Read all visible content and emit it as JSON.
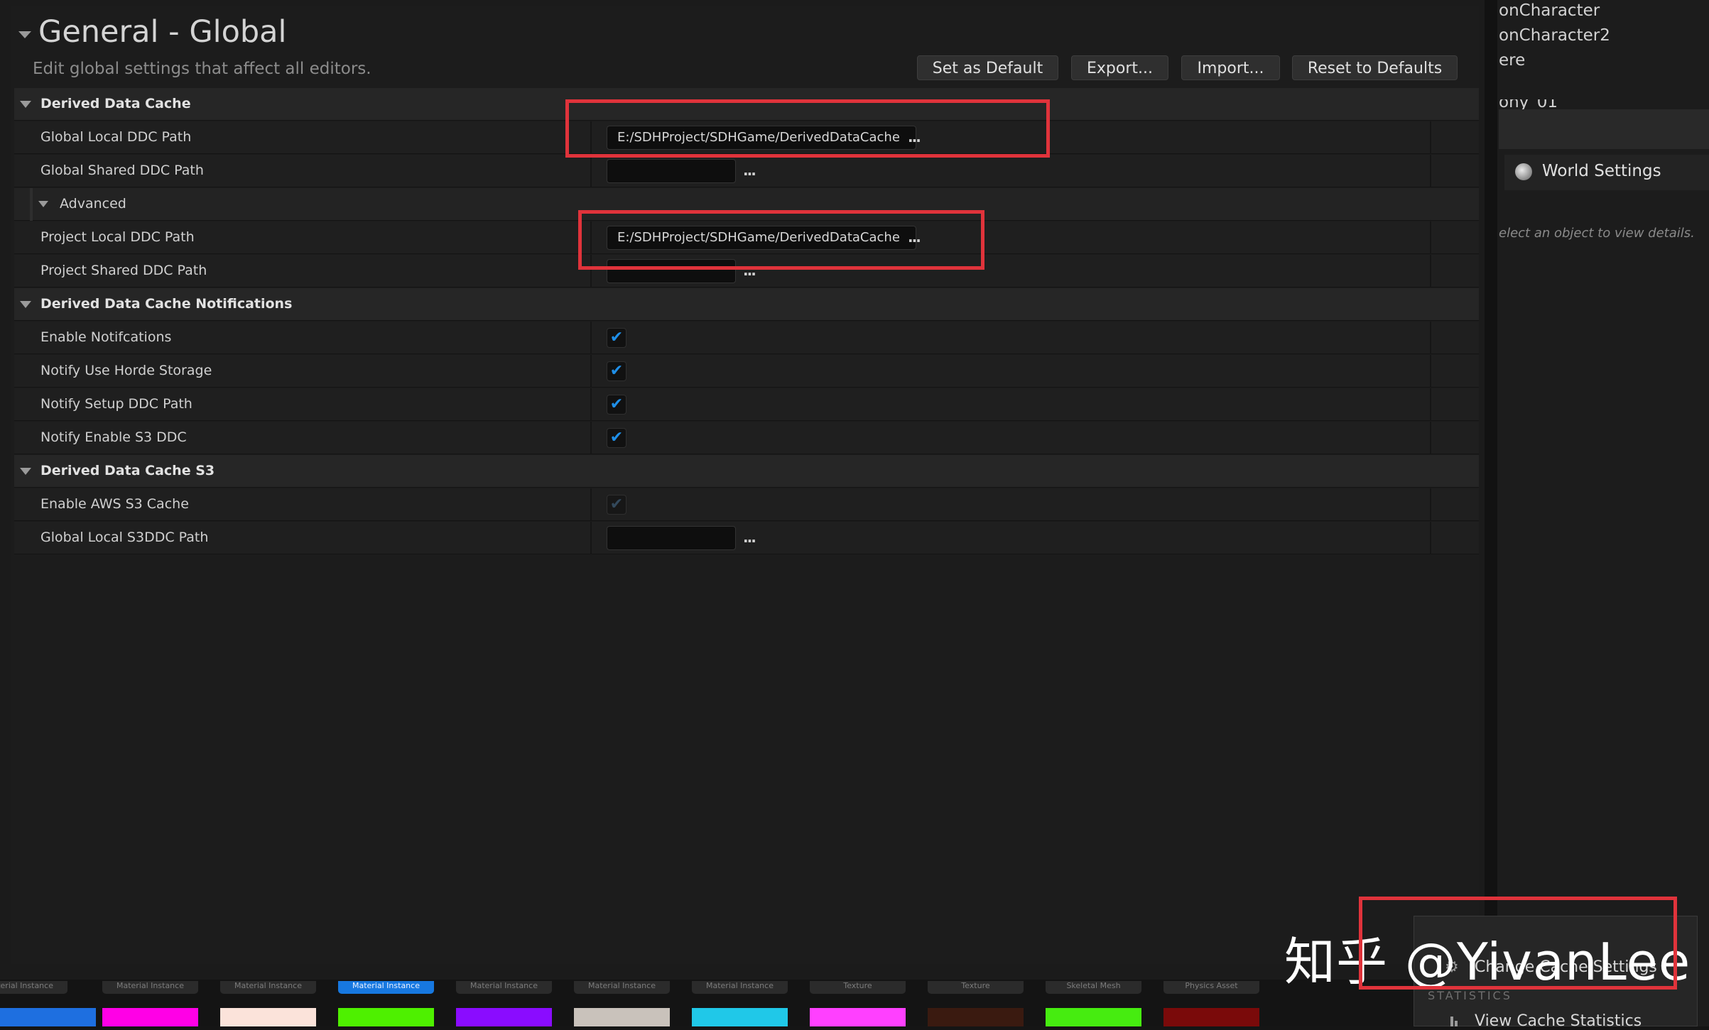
{
  "header": {
    "title": "General - Global",
    "subtitle": "Edit global settings that affect all editors.",
    "buttons": {
      "set_default": "Set as Default",
      "export": "Export...",
      "import": "Import...",
      "reset": "Reset to Defaults"
    }
  },
  "sections": {
    "ddc": {
      "title": "Derived Data Cache",
      "global_local_label": "Global Local DDC Path",
      "global_local_value": "E:/SDHProject/SDHGame/DerivedDataCache",
      "global_shared_label": "Global Shared DDC Path",
      "advanced_label": "Advanced",
      "project_local_label": "Project Local DDC Path",
      "project_local_value": "E:/SDHProject/SDHGame/DerivedDataCache",
      "project_shared_label": "Project Shared DDC Path"
    },
    "notifications": {
      "title": "Derived Data Cache Notifications",
      "enable_label": "Enable Notifcations",
      "horde_label": "Notify Use Horde Storage",
      "setup_label": "Notify Setup DDC Path",
      "s3_label": "Notify Enable S3 DDC"
    },
    "s3": {
      "title": "Derived Data Cache S3",
      "enable_aws_label": "Enable AWS S3 Cache",
      "global_local_s3_label": "Global Local S3DDC Path"
    }
  },
  "ellipsis": "...",
  "checkmark": "✔",
  "checkbox_states": {
    "enable_notifications": true,
    "notify_horde": true,
    "notify_setup": true,
    "notify_s3": true,
    "enable_aws_s3": true
  },
  "outliner": {
    "items": [
      "onCharacter",
      "onCharacter2",
      "ere",
      "ony_01"
    ]
  },
  "details": {
    "tab_label": "World Settings",
    "hint": "elect an object to view details."
  },
  "content_browser": {
    "tags": [
      "Material Instance",
      "Material Instance",
      "Material Instance",
      "Material Instance",
      "Material Instance",
      "Material Instance",
      "Material Instance",
      "Texture",
      "Texture",
      "Skeletal Mesh",
      "Physics Asset"
    ],
    "selected_tag_index": 3,
    "thumb_colors": [
      "#1e6fe0",
      "#ff00e6",
      "#fbe3da",
      "#4ef000",
      "#8a0cff",
      "#c9c2bb",
      "#20c8e8",
      "#ff40ff",
      "#3a1a10",
      "#46ec10",
      "#7a0a0a"
    ]
  },
  "popup": {
    "change_settings": "Change Cache Settings",
    "statistics_header": "STATISTICS",
    "view_stats": "View Cache Statistics"
  },
  "watermark": "知乎 @YivanLee",
  "colors": {
    "highlight": "#e0333b",
    "checkbox_check": "#1f8fe8",
    "selected_tag": "#1778e0"
  }
}
